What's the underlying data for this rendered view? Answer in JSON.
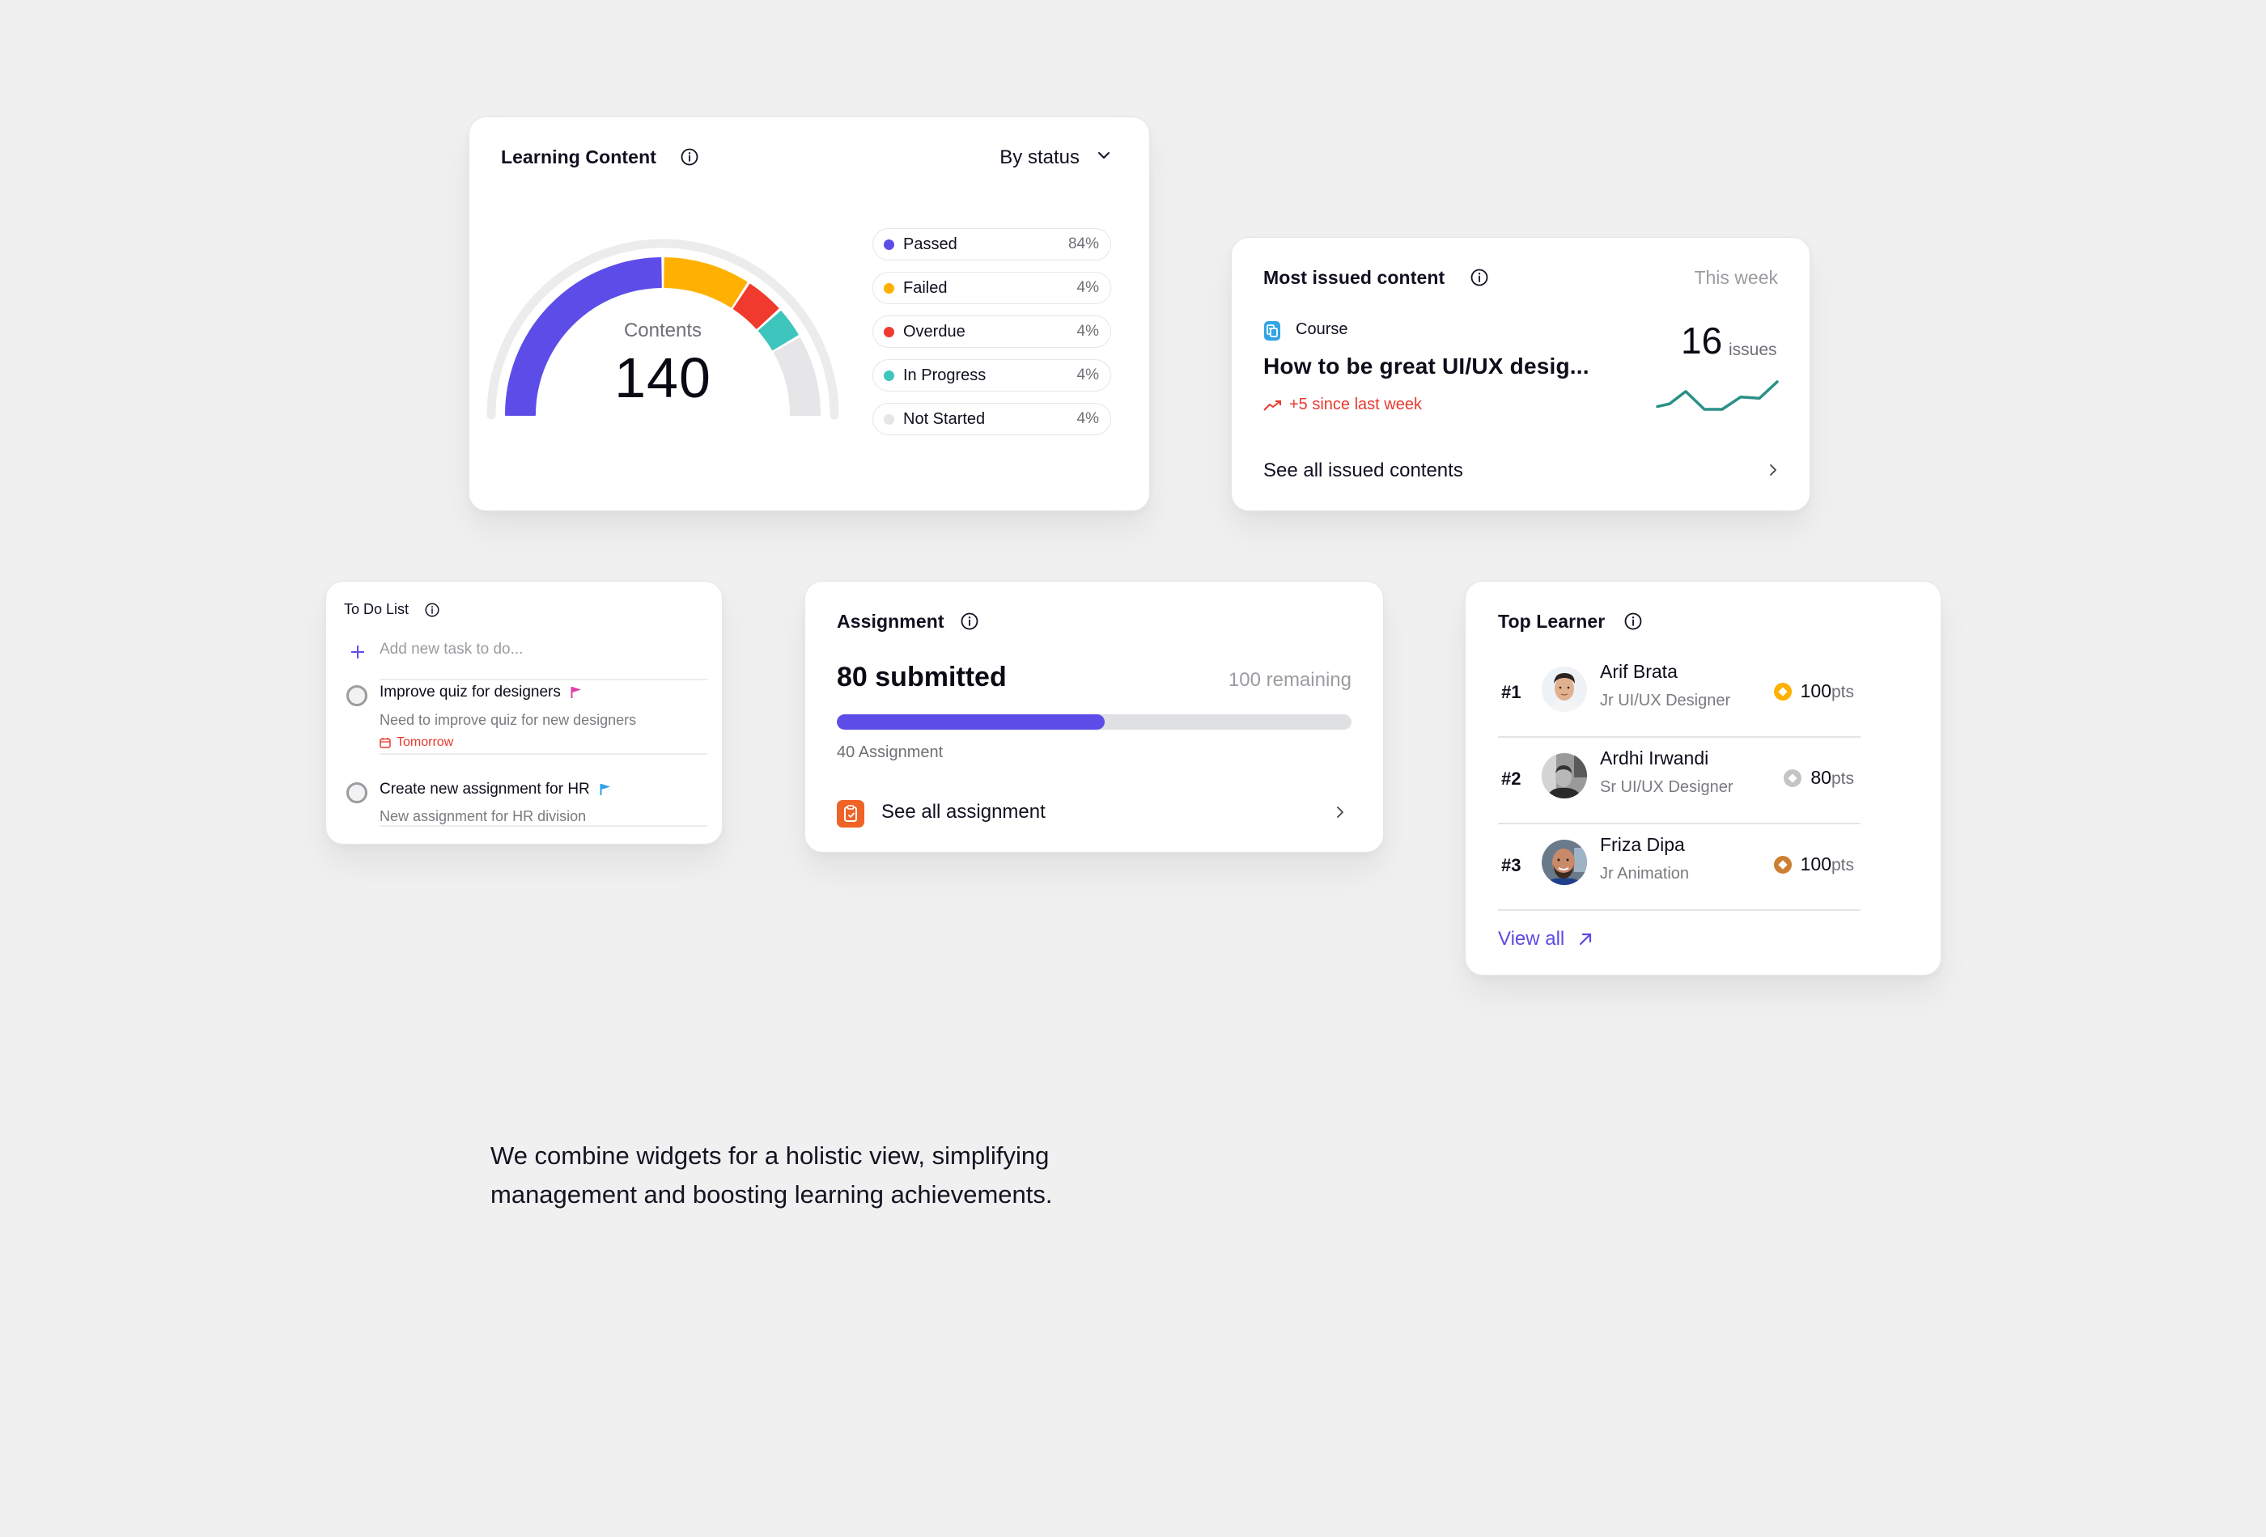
{
  "colors": {
    "background": "#f0f0f0",
    "accent": "#5d4de8",
    "passed": "#5d4de8",
    "failed": "#ffb000",
    "overdue": "#ef3a2d",
    "in_progress": "#3ec5bd",
    "not_started": "#e6e6e8",
    "danger": "#e8392d",
    "sparkline": "#2a9087",
    "course_icon": "#33a4e6",
    "assignment_icon": "#ef6326",
    "gold": "#ffb000",
    "silver": "#c4c4c6",
    "bronze": "#cd7f32"
  },
  "learning_content": {
    "title": "Learning Content",
    "filter_label": "By status",
    "center_label": "Contents",
    "total": "140",
    "legend": [
      {
        "label": "Passed",
        "percent": "84%",
        "color": "#5d4de8"
      },
      {
        "label": "Failed",
        "percent": "4%",
        "color": "#ffb000"
      },
      {
        "label": "Overdue",
        "percent": "4%",
        "color": "#ef3a2d"
      },
      {
        "label": "In Progress",
        "percent": "4%",
        "color": "#3ec5bd"
      },
      {
        "label": "Not Started",
        "percent": "4%",
        "color": "#e6e6e8"
      }
    ]
  },
  "chart_data": {
    "type": "gauge",
    "title": "Learning Content",
    "center_label": "Contents",
    "total": 140,
    "categories": [
      "Passed",
      "Failed",
      "Overdue",
      "In Progress",
      "Not Started"
    ],
    "legend_values_percent": [
      84,
      4,
      4,
      4,
      4
    ],
    "displayed_arc_degrees": [
      90,
      33,
      15,
      12,
      30
    ],
    "arc_range_degrees": 180,
    "colors": [
      "#5d4de8",
      "#ffb000",
      "#ef3a2d",
      "#3ec5bd",
      "#e6e6e8"
    ],
    "legend_position": "right"
  },
  "most_issued": {
    "title": "Most issued content",
    "period": "This week",
    "content_type": "Course",
    "content_title": "How to be great UI/UX desig...",
    "trend_text": "+5 since last week",
    "count": "16",
    "count_unit": "issues",
    "sparkline": [
      1,
      2,
      6.5,
      0,
      0,
      4.5,
      4,
      10
    ],
    "link_label": "See all issued contents"
  },
  "todo": {
    "title": "To Do List",
    "add_placeholder": "Add new task to do...",
    "tasks": [
      {
        "title": "Improve quiz for designers",
        "description": "Need to improve quiz for new designers",
        "due": "Tomorrow",
        "flag_color": "#e040a8",
        "done": false
      },
      {
        "title": "Create new assignment for HR",
        "description": "New assignment for HR division",
        "due": null,
        "flag_color": "#2fa0e6",
        "done": false
      }
    ]
  },
  "assignment": {
    "title": "Assignment",
    "submitted_label": "80 submitted",
    "remaining_label": "100 remaining",
    "progress_percent": 52,
    "count_label": "40 Assignment",
    "link_label": "See all assignment"
  },
  "top_learner": {
    "title": "Top Learner",
    "learners": [
      {
        "rank": "#1",
        "name": "Arif Brata",
        "role": "Jr UI/UX Designer",
        "points": "100",
        "points_unit": "pts",
        "medal": "gold"
      },
      {
        "rank": "#2",
        "name": "Ardhi Irwandi",
        "role": "Sr UI/UX Designer",
        "points": "80",
        "points_unit": "pts",
        "medal": "silver"
      },
      {
        "rank": "#3",
        "name": "Friza Dipa",
        "role": "Jr Animation",
        "points": "100",
        "points_unit": "pts",
        "medal": "bronze"
      }
    ],
    "view_all_label": "View all"
  },
  "caption": "We combine widgets for a holistic view, simplifying management and boosting learning achievements."
}
